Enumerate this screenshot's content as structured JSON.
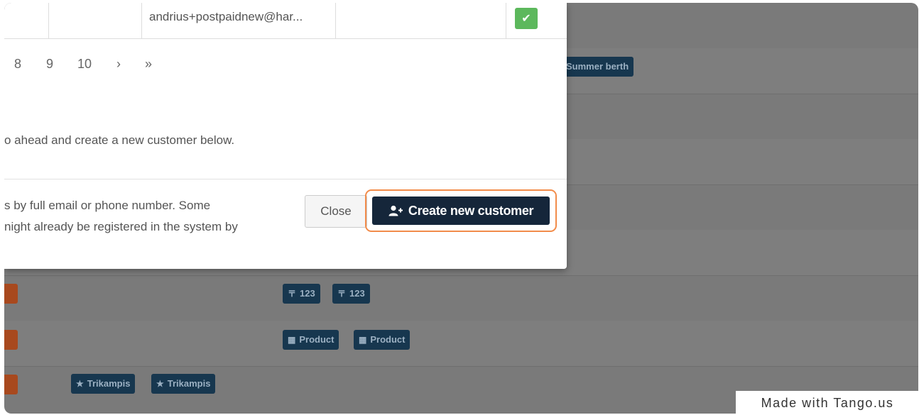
{
  "modal": {
    "table_row": {
      "email": "andrius+postpaidnew@har...",
      "check_icon": "check-icon"
    },
    "pagination": [
      "8",
      "9",
      "10",
      "›",
      "»"
    ],
    "info_text": "o ahead and create a new customer below.",
    "footer_text_line1": "s by full email or phone number. Some",
    "footer_text_line2": "night already be registered in the system by",
    "close_label": "Close",
    "create_label": "Create new customer"
  },
  "background": {
    "summer_tag": "Summer berth",
    "tags_row1": [
      "123",
      "123"
    ],
    "tags_row2": [
      "Product",
      "Product"
    ],
    "tags_row3": [
      "Trikampis",
      "Trikampis"
    ]
  },
  "colors": {
    "accent": "#15263a",
    "highlight": "#f28c4a",
    "success": "#5cb85c"
  },
  "watermark": "Made with Tango.us"
}
